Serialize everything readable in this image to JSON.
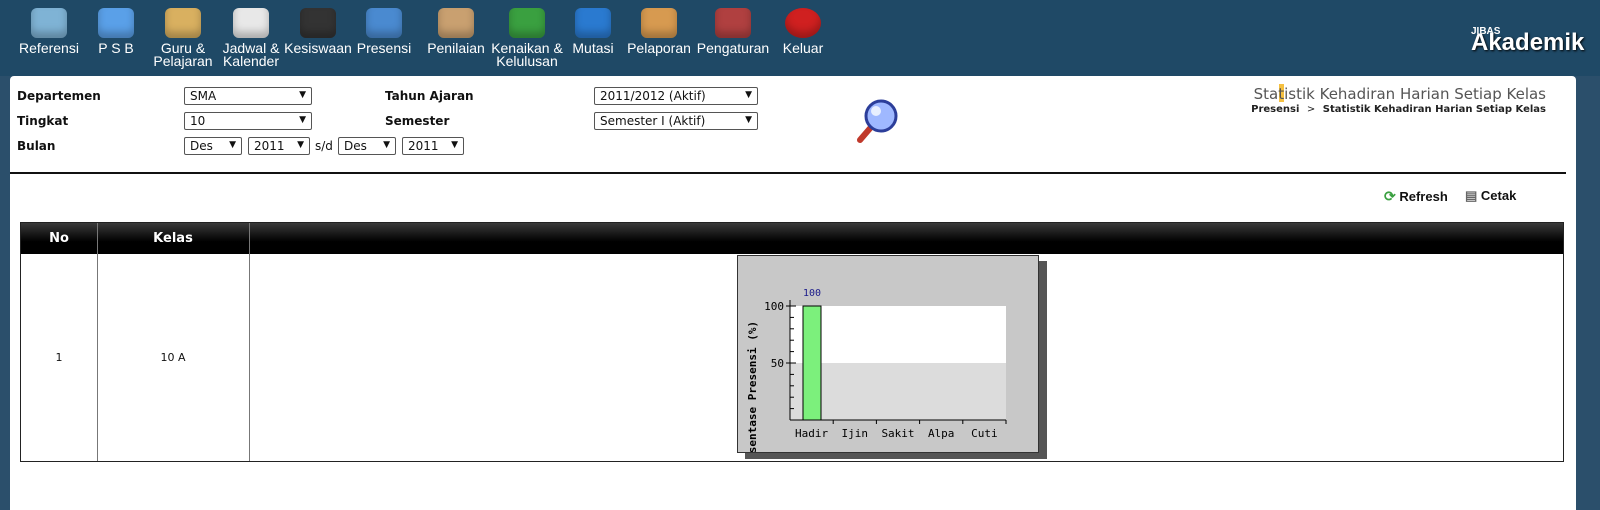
{
  "nav": [
    {
      "label": "Referensi",
      "icon": "referensi-icon",
      "color": "#7fb3d5"
    },
    {
      "label": "P S B",
      "icon": "users-icon",
      "color": "#5aa0e8"
    },
    {
      "label": "Guru &\nPelajaran",
      "icon": "teacher-icon",
      "color": "#d9b060"
    },
    {
      "label": "Jadwal &\nKalender",
      "icon": "calendar-icon",
      "color": "#e8e8e8"
    },
    {
      "label": "Kesiswaan",
      "icon": "student-icon",
      "color": "#333333"
    },
    {
      "label": "Presensi",
      "icon": "keyboard-icon",
      "color": "#4a8ad0"
    },
    {
      "label": "Penilaian",
      "icon": "handshake-icon",
      "color": "#c9a070"
    },
    {
      "label": "Kenaikan &\nKelulusan",
      "icon": "arrows-icon",
      "color": "#3aa040"
    },
    {
      "label": "Mutasi",
      "icon": "runner-icon",
      "color": "#2a7ad0"
    },
    {
      "label": "Pelaporan",
      "icon": "report-icon",
      "color": "#d79a50"
    },
    {
      "label": "Pengaturan",
      "icon": "tools-icon",
      "color": "#b04040"
    },
    {
      "label": "Keluar",
      "icon": "power-icon",
      "color": "#d02020"
    }
  ],
  "brand": {
    "small": "JIBAS",
    "name": "Akademik"
  },
  "filters": {
    "departemen_label": "Departemen",
    "departemen_value": "SMA",
    "tingkat_label": "Tingkat",
    "tingkat_value": "10",
    "bulan_label": "Bulan",
    "bulan_from": "Des",
    "tahun_from": "2011",
    "sd": "s/d",
    "bulan_to": "Des",
    "tahun_to": "2011",
    "tahun_ajaran_label": "Tahun Ajaran",
    "tahun_ajaran_value": "2011/2012 (Aktif)",
    "semester_label": "Semester",
    "semester_value": "Semester I (Aktif)"
  },
  "page": {
    "title": "Statistik Kehadiran Harian Setiap Kelas",
    "crumb_parent": "Presensi",
    "crumb_sep": ">",
    "crumb_current": "Statistik Kehadiran Harian Setiap Kelas"
  },
  "toolbar": {
    "refresh": "Refresh",
    "cetak": "Cetak"
  },
  "table": {
    "headers": [
      "No",
      "Kelas",
      ""
    ],
    "rows": [
      {
        "no": "1",
        "kelas": "10 A"
      }
    ]
  },
  "chart_data": {
    "type": "bar",
    "categories": [
      "Hadir",
      "Ijin",
      "Sakit",
      "Alpa",
      "Cuti"
    ],
    "values": [
      100,
      0,
      0,
      0,
      0
    ],
    "data_labels": [
      "100",
      "",
      "",
      "",
      ""
    ],
    "ylabel": "Presentase Presensi (%)",
    "yticks": [
      50,
      100
    ],
    "ylim": [
      0,
      100
    ],
    "bar_color": "#7cf07c"
  }
}
